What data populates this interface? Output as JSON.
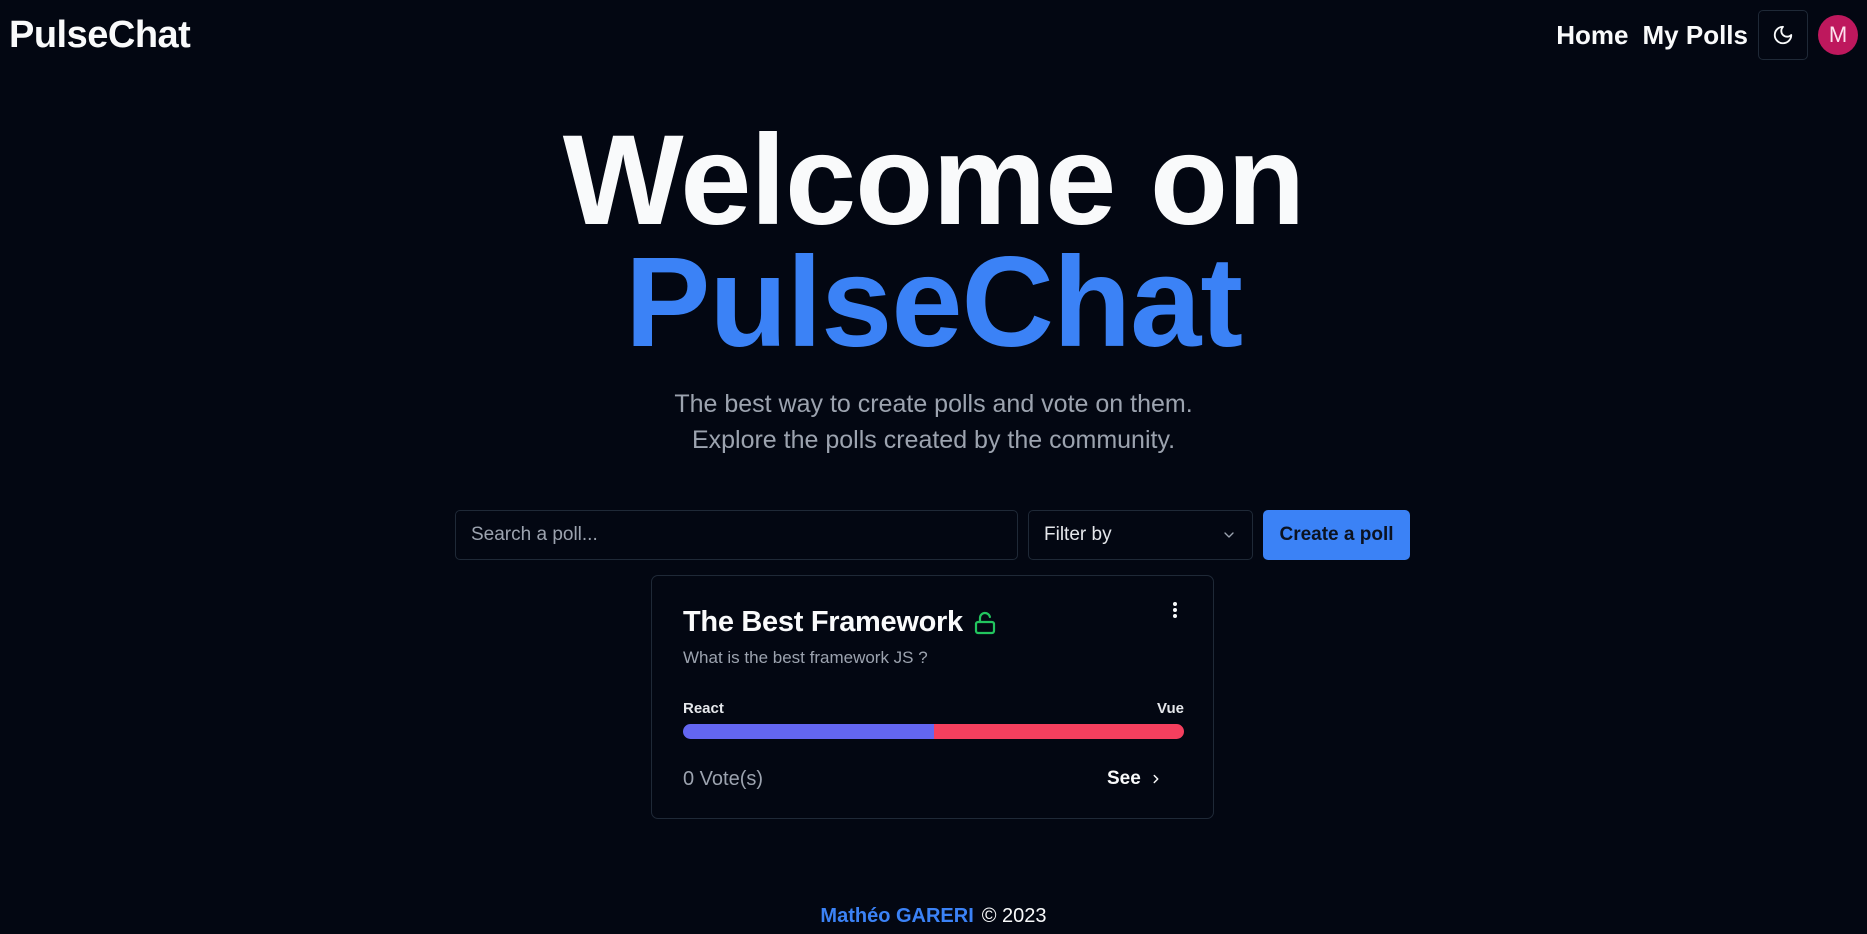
{
  "header": {
    "brand": "PulseChat",
    "nav": [
      {
        "label": "Home"
      },
      {
        "label": "My Polls"
      }
    ],
    "theme_icon": "moon-icon",
    "avatar_initial": "M"
  },
  "hero": {
    "line1": "Welcome on",
    "line2": "PulseChat",
    "subtitle_line1": "The best way to create polls and vote on them.",
    "subtitle_line2": "Explore the polls created by the community."
  },
  "controls": {
    "search_placeholder": "Search a poll...",
    "filter_label": "Filter by",
    "create_label": "Create a poll"
  },
  "poll": {
    "title": "The Best Framework",
    "status_icon": "unlock-icon",
    "description": "What is the best framework JS ?",
    "options": [
      {
        "label": "React",
        "share": 0.5
      },
      {
        "label": "Vue",
        "share": 0.5
      }
    ],
    "votes": "0 Vote(s)",
    "see_label": "See"
  },
  "footer": {
    "author": "Mathéo GARERI",
    "copyright": "© 2023"
  },
  "colors": {
    "background": "#030712",
    "accent": "#3b82f6",
    "option_a": "#6366f1",
    "option_b": "#f43f5e",
    "lock": "#22c55e",
    "avatar": "#be185d"
  }
}
